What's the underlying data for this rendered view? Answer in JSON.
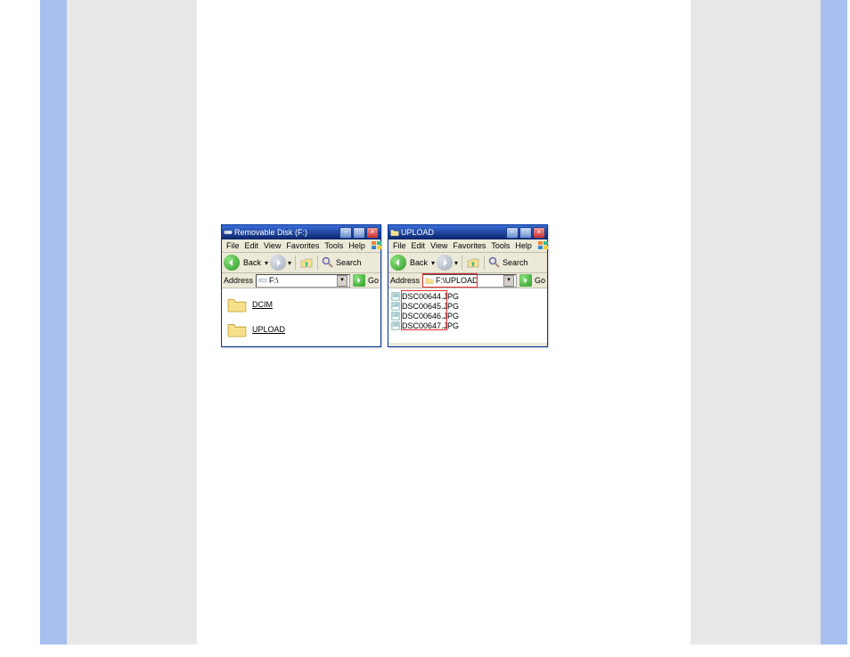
{
  "windows": [
    {
      "title": "Removable Disk (F:)",
      "menus": [
        "File",
        "Edit",
        "View",
        "Favorites",
        "Tools",
        "Help"
      ],
      "toolbar": {
        "back_label": "Back",
        "search_label": "Search"
      },
      "address": {
        "label": "Address",
        "value": "F:\\",
        "go_label": "Go"
      },
      "folders": [
        {
          "name": "DCIM"
        },
        {
          "name": "UPLOAD"
        }
      ]
    },
    {
      "title": "UPLOAD",
      "menus": [
        "File",
        "Edit",
        "View",
        "Favorites",
        "Tools",
        "Help"
      ],
      "toolbar": {
        "back_label": "Back",
        "search_label": "Search"
      },
      "address": {
        "label": "Address",
        "value": "F:\\UPLOAD",
        "go_label": "Go"
      },
      "files": [
        {
          "name": "DSC00644.JPG"
        },
        {
          "name": "DSC00645.JPG"
        },
        {
          "name": "DSC00646.JPG"
        },
        {
          "name": "DSC00647.JPG"
        }
      ]
    }
  ]
}
